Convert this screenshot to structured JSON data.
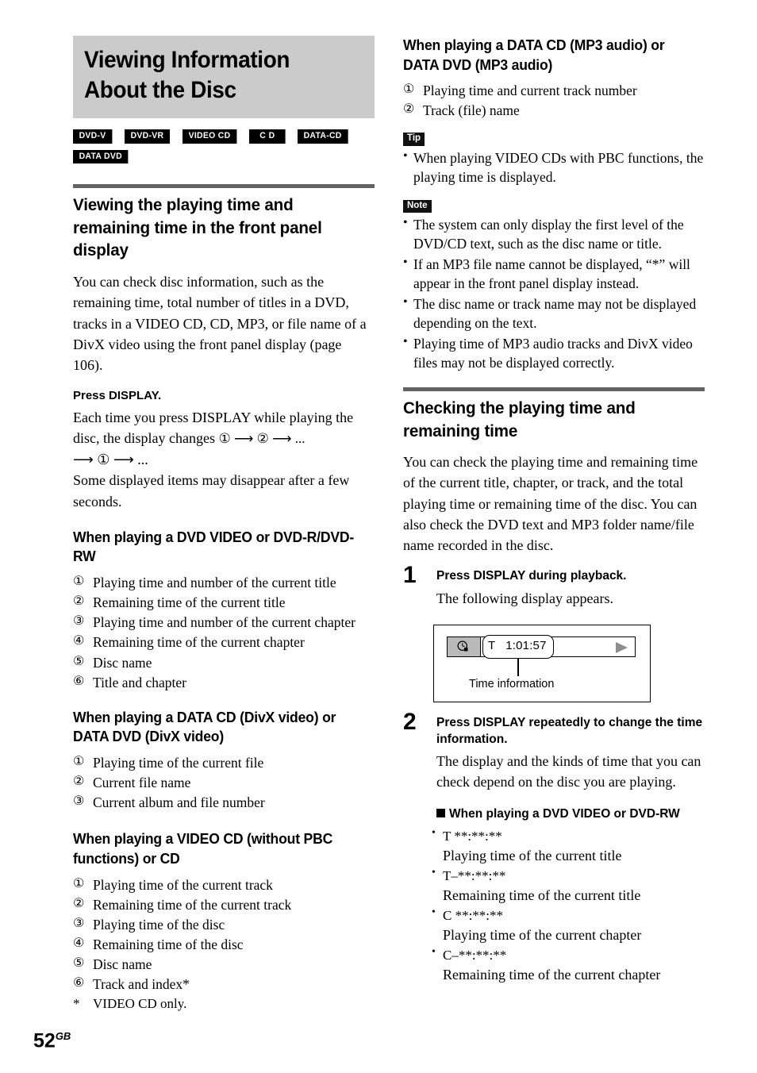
{
  "page": {
    "number": "52",
    "region_suffix": "GB"
  },
  "title": {
    "text": "Viewing Information About the Disc"
  },
  "disc_badges": [
    {
      "label": "DVD-V"
    },
    {
      "label": "DVD-VR"
    },
    {
      "label": "VIDEO CD"
    },
    {
      "label": "CD"
    },
    {
      "label": "DATA-CD"
    },
    {
      "label": "DATA DVD"
    }
  ],
  "left_column": {
    "section_heading": "Viewing the playing time and remaining time in the front panel display",
    "intro_paragraph": "You can check disc information, such as the remaining time, total number of titles in a DVD, tracks in a VIDEO CD, CD, MP3, or file name of a DivX video using the front panel display (page 106).",
    "press_display_heading": "Press DISPLAY.",
    "press_display_body_1": "Each time you press DISPLAY while playing the disc, the display changes",
    "press_display_sequence_1": "① ⟶ ② ⟶ ...",
    "press_display_sequence_2": "⟶ ① ⟶ ...",
    "press_display_body_2": "Some displayed items may disappear after a few seconds.",
    "dvd_video_heading": "When playing a DVD VIDEO or DVD-R/DVD-RW",
    "dvd_video_items": [
      {
        "marker": "①",
        "text": "Playing time and number of the current title"
      },
      {
        "marker": "②",
        "text": "Remaining time of the current title"
      },
      {
        "marker": "③",
        "text": "Playing time and number of the current chapter"
      },
      {
        "marker": "④",
        "text": "Remaining time of the current chapter"
      },
      {
        "marker": "⑤",
        "text": "Disc name"
      },
      {
        "marker": "⑥",
        "text": "Title and chapter"
      }
    ],
    "divx_heading": "When playing a DATA CD (DivX video) or DATA DVD (DivX video)",
    "divx_items": [
      {
        "marker": "①",
        "text": "Playing time of the current file"
      },
      {
        "marker": "②",
        "text": "Current file name"
      },
      {
        "marker": "③",
        "text": "Current album and file number"
      }
    ],
    "videocd_heading": "When playing a VIDEO CD (without PBC functions) or CD",
    "videocd_items": [
      {
        "marker": "①",
        "text": "Playing time of the current track"
      },
      {
        "marker": "②",
        "text": "Remaining time of the current track"
      },
      {
        "marker": "③",
        "text": "Playing time of the disc"
      },
      {
        "marker": "④",
        "text": "Remaining time of the disc"
      },
      {
        "marker": "⑤",
        "text": "Disc name"
      },
      {
        "marker": "⑥",
        "text": "Track and index*"
      }
    ],
    "videocd_footnote_marker": "*",
    "videocd_footnote": "VIDEO CD only."
  },
  "right_column": {
    "mp3_heading": "When playing a DATA CD (MP3 audio) or DATA DVD (MP3 audio)",
    "mp3_items": [
      {
        "marker": "①",
        "text": "Playing time and current track number"
      },
      {
        "marker": "②",
        "text": "Track (file) name"
      }
    ],
    "tip_label": "Tip",
    "tip_items": [
      "When playing VIDEO CDs with PBC functions, the playing time is displayed."
    ],
    "note_label": "Note",
    "note_items": [
      "The system can only display the first level of the DVD/CD text, such as the disc name or title.",
      "If an MP3 file name cannot be displayed, “*” will appear in the front panel display instead.",
      "The disc name or track name may not be displayed depending on the text.",
      "Playing time of MP3 audio tracks and DivX video files may not be displayed correctly."
    ],
    "checking_heading": "Checking the playing time and remaining time",
    "checking_body": "You can check the playing time and remaining time of the current title, chapter, or track, and the total playing time or remaining time of the disc. You can also check the DVD text and MP3 folder name/file name recorded in the disc.",
    "step1": {
      "number": "1",
      "title": "Press DISPLAY during playback.",
      "body": "The following display appears."
    },
    "figure": {
      "time_value": "T   1:01:57",
      "caption": "Time information",
      "clock_icon": "clock-icon",
      "play_icon": "play-triangle-icon"
    },
    "step2": {
      "number": "2",
      "title": "Press DISPLAY repeatedly to change the time information.",
      "body": "The display and the kinds of time that you can check depend on the disc you are playing."
    },
    "dvd_time_heading": "When playing a DVD VIDEO or DVD-RW",
    "dvd_time_items": [
      {
        "code": "T **:**:**",
        "desc": "Playing time of the current title"
      },
      {
        "code": "T–**:**:**",
        "desc": "Remaining time of the current title"
      },
      {
        "code": "C **:**:**",
        "desc": "Playing time of the current chapter"
      },
      {
        "code": "C–**:**:**",
        "desc": "Remaining time of the current chapter"
      }
    ]
  },
  "colors": {
    "title_banner_bg": "#cbcbcb",
    "section_rule": "#636363",
    "badge_bg": "#000000",
    "figure_swatch": "#b9b9b9",
    "play_triangle": "#8e8e8e"
  }
}
